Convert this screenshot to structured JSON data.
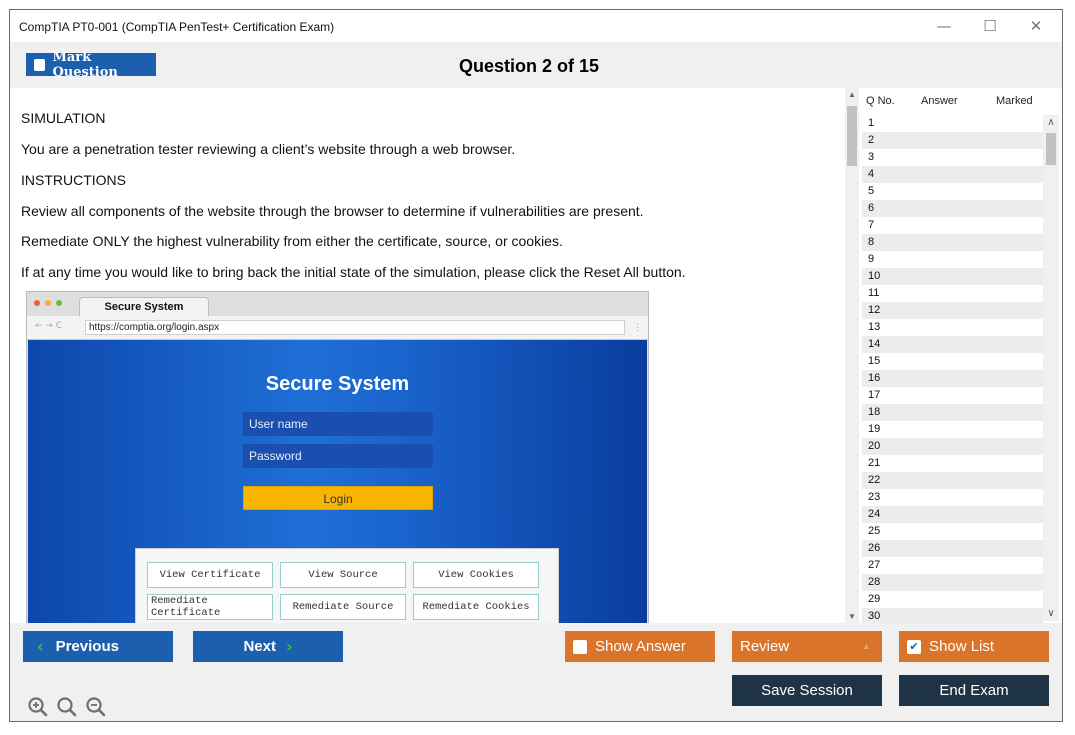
{
  "window": {
    "title": "CompTIA PT0-001 (CompTIA PenTest+ Certification Exam)",
    "minimize": "—",
    "maximize": "☐",
    "close": "✕"
  },
  "header": {
    "mark_label": "Mark Question",
    "question_title": "Question 2 of 15"
  },
  "content": {
    "paragraphs": [
      "SIMULATION",
      "You are a penetration tester reviewing a client’s website through a web browser.",
      "INSTRUCTIONS",
      "Review all components of the website through the browser to determine if vulnerabilities are present.",
      "Remediate ONLY the highest vulnerability from either the certificate, source, or cookies.",
      "If at any time you would like to bring back the initial state of the simulation, please click the Reset All button."
    ],
    "scroll_up": "▲",
    "scroll_down": "▼"
  },
  "browser": {
    "tab_title": "Secure System",
    "nav_icons": "← → C",
    "url": "https://comptia.org/login.aspx",
    "menu_icon": "⋮",
    "site_title": "Secure System",
    "username_placeholder": "User name",
    "password_placeholder": "Password",
    "login_label": "Login",
    "buttons": {
      "view_certificate": "View Certificate",
      "view_source": "View Source",
      "view_cookies": "View Cookies",
      "remediate_certificate": "Remediate Certificate",
      "remediate_source": "Remediate Source",
      "remediate_cookies": "Remediate Cookies"
    },
    "dot_colors": [
      "#f2594b",
      "#f4b22e",
      "#5ec03f"
    ]
  },
  "qlist": {
    "headers": {
      "qno": "Q No.",
      "answer": "Answer",
      "marked": "Marked"
    },
    "rows": [
      "1",
      "2",
      "3",
      "4",
      "5",
      "6",
      "7",
      "8",
      "9",
      "10",
      "11",
      "12",
      "13",
      "14",
      "15",
      "16",
      "17",
      "18",
      "19",
      "20",
      "21",
      "22",
      "23",
      "24",
      "25",
      "26",
      "27",
      "28",
      "29",
      "30"
    ],
    "scroll_up": "∧",
    "scroll_down": "∨"
  },
  "footer": {
    "previous_label": "Previous",
    "previous_icon": "‹",
    "next_label": "Next",
    "next_icon": "›",
    "show_answer_label": "Show Answer",
    "review_label": "Review",
    "review_arrow": "▲",
    "show_list_label": "Show List",
    "show_list_checked": "✔",
    "save_session_label": "Save Session",
    "end_exam_label": "End Exam"
  },
  "colors": {
    "primary_blue": "#1c5fae",
    "orange": "#d9742a",
    "dark_navy": "#1e3346",
    "accent_green": "#32c832"
  }
}
